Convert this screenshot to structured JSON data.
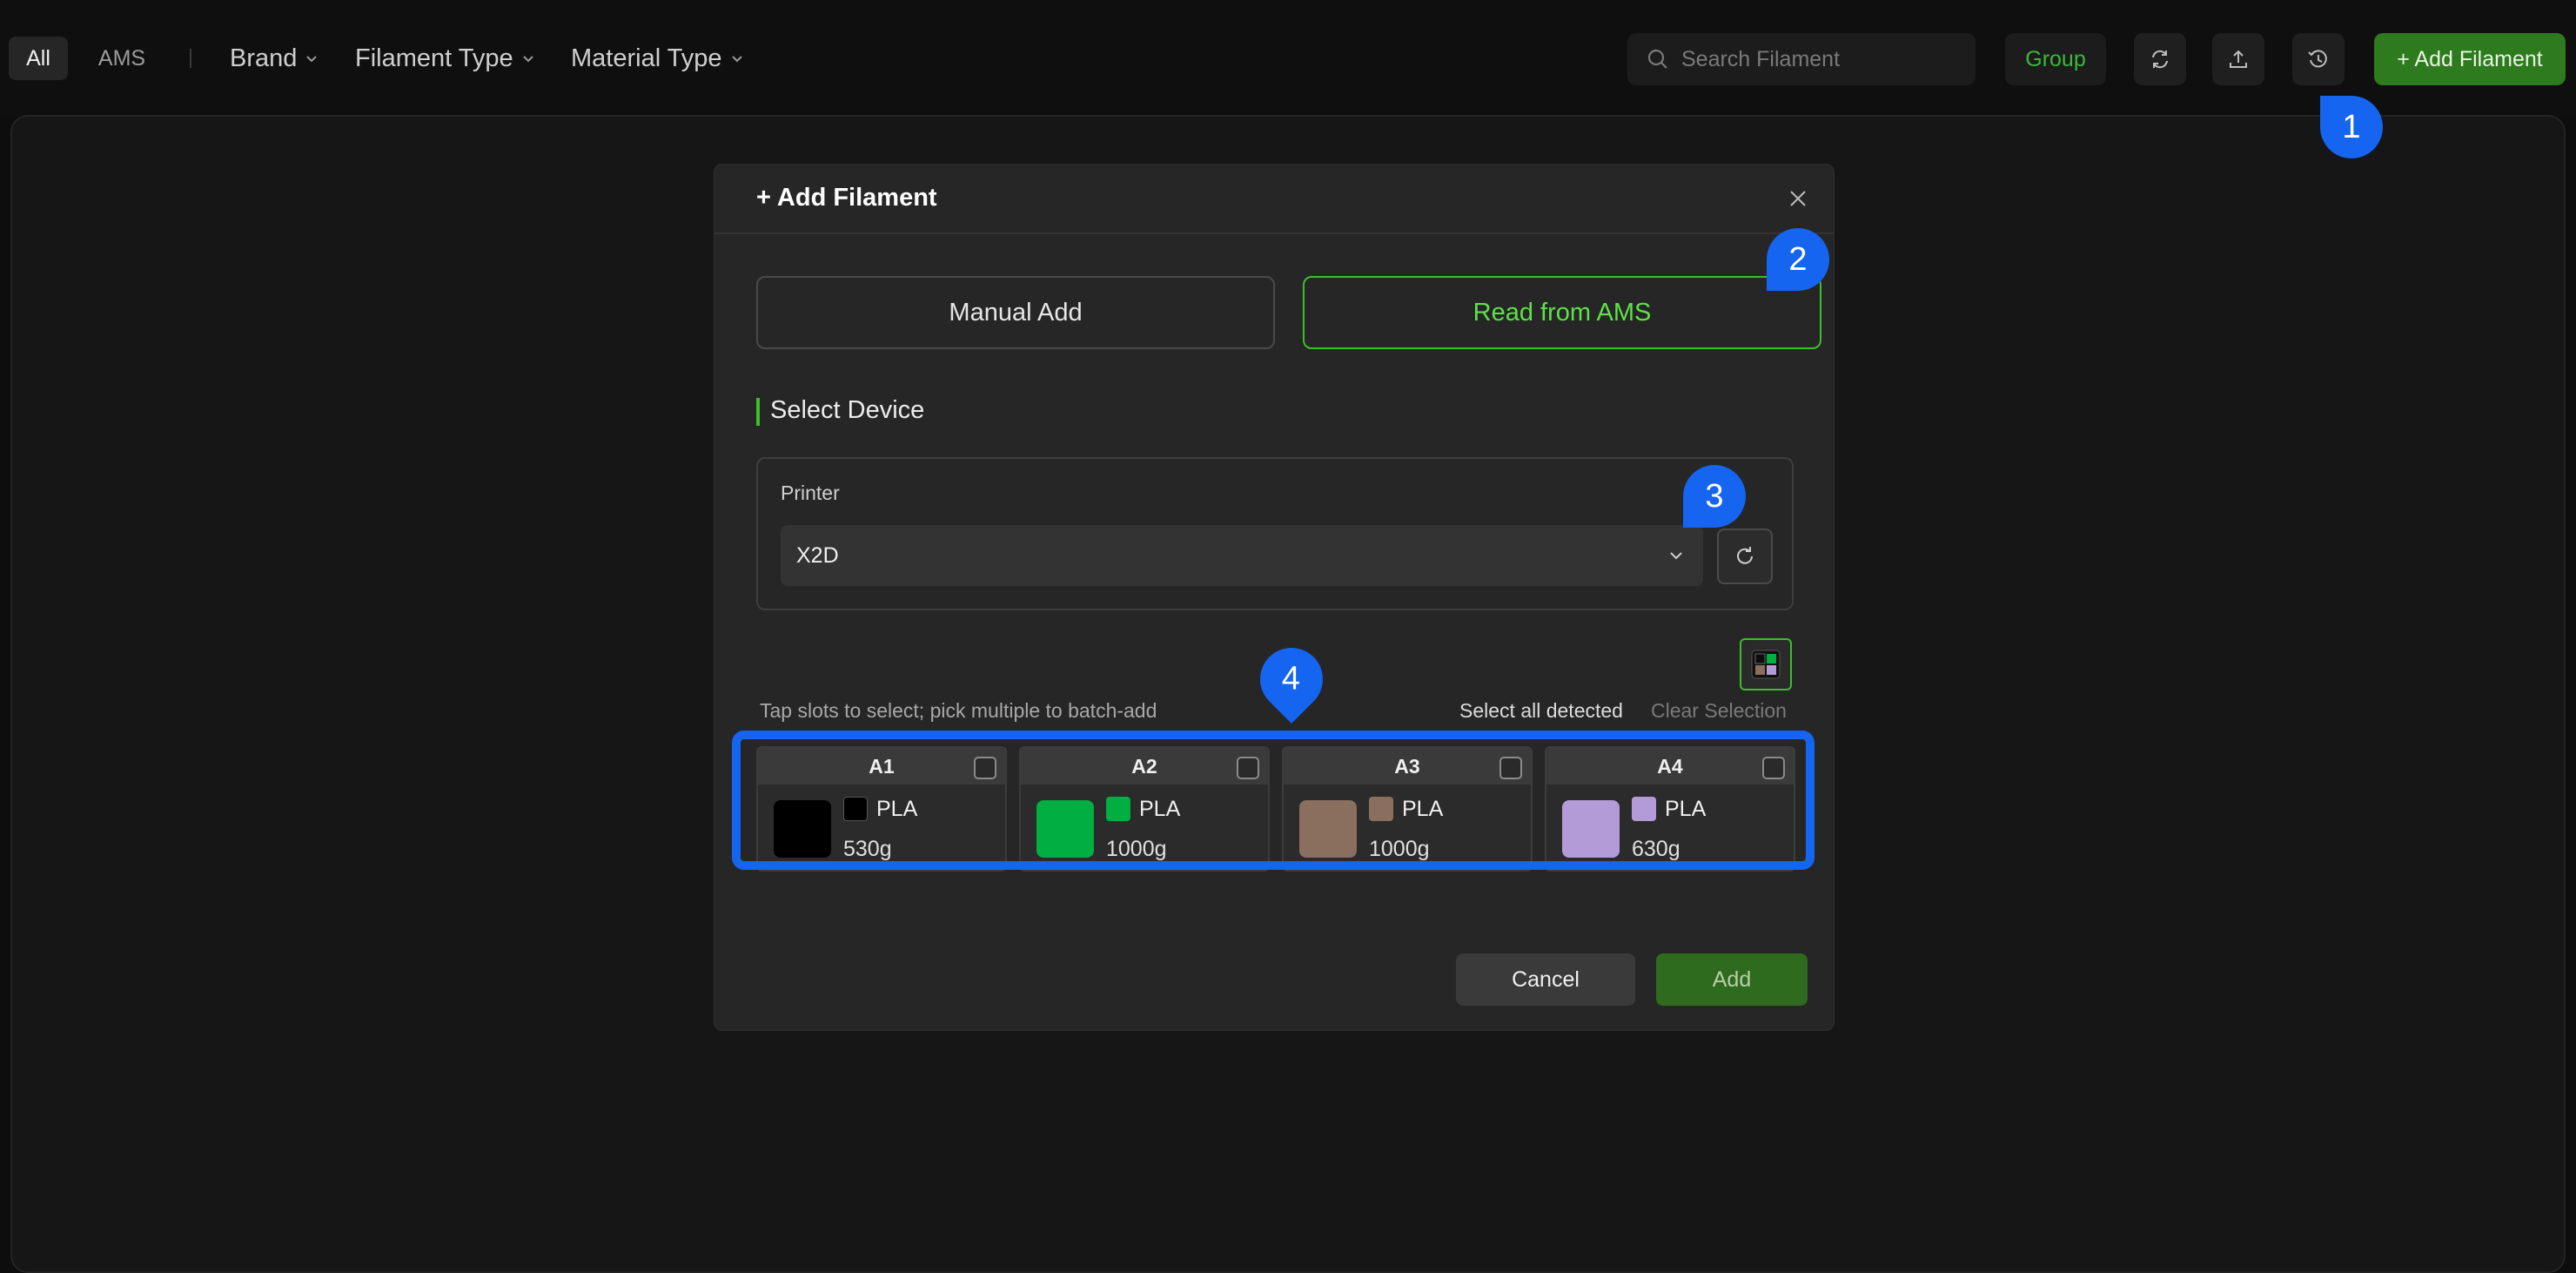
{
  "topbar": {
    "tabs": [
      {
        "label": "All",
        "active": true
      },
      {
        "label": "AMS",
        "active": false
      }
    ],
    "filters": [
      {
        "label": "Brand"
      },
      {
        "label": "Filament Type"
      },
      {
        "label": "Material Type"
      }
    ],
    "search_placeholder": "Search Filament",
    "group_label": "Group",
    "add_filament_label": "+ Add Filament"
  },
  "dialog": {
    "title": "+ Add Filament",
    "modes": {
      "manual_label": "Manual Add",
      "ams_label": "Read from AMS",
      "selected": "ams"
    },
    "section_title": "Select Device",
    "printer_label": "Printer",
    "printer_value": "X2D",
    "hint": "Tap slots to select; pick multiple to batch-add",
    "select_all_label": "Select all detected",
    "clear_selection_label": "Clear Selection",
    "slots": [
      {
        "name": "A1",
        "type": "PLA",
        "weight": "530g",
        "color": "#000000"
      },
      {
        "name": "A2",
        "type": "PLA",
        "weight": "1000g",
        "color": "#00ae42"
      },
      {
        "name": "A3",
        "type": "PLA",
        "weight": "1000g",
        "color": "#8a6e5e"
      },
      {
        "name": "A4",
        "type": "PLA",
        "weight": "630g",
        "color": "#b39bd8"
      }
    ],
    "cancel_label": "Cancel",
    "add_label": "Add"
  },
  "markers": [
    {
      "label": "1"
    },
    {
      "label": "2"
    },
    {
      "label": "3"
    },
    {
      "label": "4"
    }
  ],
  "colors": {
    "accent_green": "#3dbd2c",
    "marker_blue": "#1565f0"
  }
}
